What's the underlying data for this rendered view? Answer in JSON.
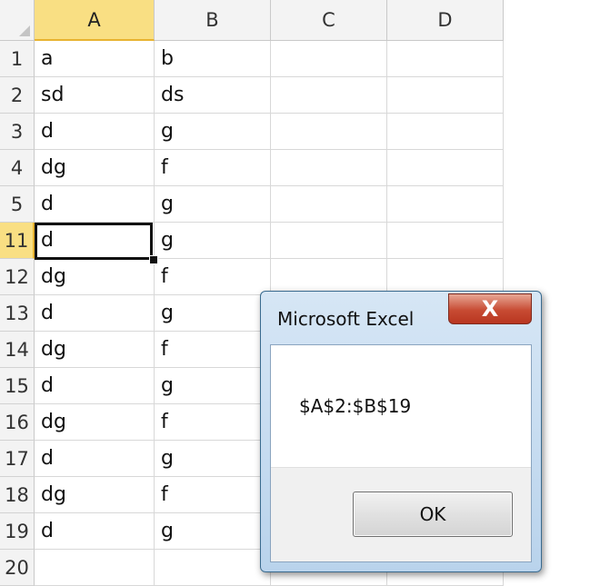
{
  "columns": [
    "A",
    "B",
    "C",
    "D"
  ],
  "rows": [
    {
      "num": "1",
      "a": "a",
      "b": "b"
    },
    {
      "num": "2",
      "a": "sd",
      "b": "ds"
    },
    {
      "num": "3",
      "a": "d",
      "b": "g"
    },
    {
      "num": "4",
      "a": "dg",
      "b": "f"
    },
    {
      "num": "5",
      "a": "d",
      "b": "g"
    },
    {
      "num": "11",
      "a": "d",
      "b": "g"
    },
    {
      "num": "12",
      "a": "dg",
      "b": "f"
    },
    {
      "num": "13",
      "a": "d",
      "b": "g"
    },
    {
      "num": "14",
      "a": "dg",
      "b": "f"
    },
    {
      "num": "15",
      "a": "d",
      "b": "g"
    },
    {
      "num": "16",
      "a": "dg",
      "b": "f"
    },
    {
      "num": "17",
      "a": "d",
      "b": "g"
    },
    {
      "num": "18",
      "a": "dg",
      "b": "f"
    },
    {
      "num": "19",
      "a": "d",
      "b": "g"
    },
    {
      "num": "20",
      "a": "",
      "b": ""
    }
  ],
  "selection": {
    "column": "A",
    "row": "11"
  },
  "dialog": {
    "title": "Microsoft Excel",
    "close_label": "X",
    "message": "$A$2:$B$19",
    "ok_label": "OK"
  },
  "colors": {
    "header_selected": "#f9df83",
    "close_button": "#c74b33"
  }
}
